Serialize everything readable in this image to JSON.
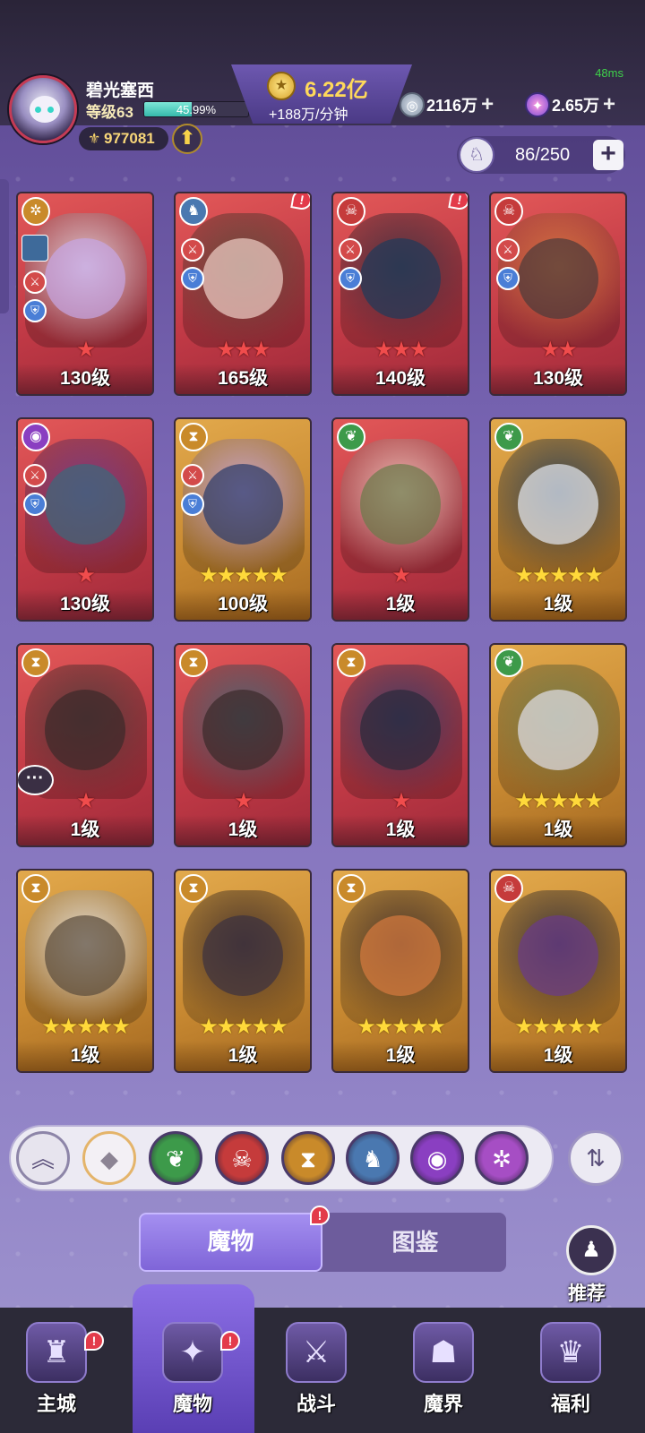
{
  "status": {
    "ping": "48ms"
  },
  "player": {
    "name": "碧光塞西",
    "level": "等级63",
    "xp_percent": "45.99%",
    "xp_fraction": 0.4599,
    "power": "977081"
  },
  "gold": {
    "amount": "6.22亿",
    "rate": "+188万/分钟"
  },
  "resources": [
    {
      "icon": "silver-coin-icon",
      "value": "2116万",
      "plus": "+"
    },
    {
      "icon": "star-gem-icon",
      "value": "2.65万",
      "plus": "+"
    }
  ],
  "capacity": {
    "value": "86/250",
    "plus": "+"
  },
  "monsters": [
    {
      "level": "130级",
      "stars": "★",
      "tier": "red",
      "faction": "purple-gold",
      "faction_icon": "swirl-faction-icon",
      "alert": false,
      "badges": true
    },
    {
      "level": "165级",
      "stars": "★★★",
      "tier": "red",
      "faction": "blue",
      "faction_icon": "dragon-faction-icon",
      "alert": true,
      "badges": true
    },
    {
      "level": "140级",
      "stars": "★★★",
      "tier": "red",
      "faction": "red",
      "faction_icon": "demon-faction-icon",
      "alert": true,
      "badges": true
    },
    {
      "level": "130级",
      "stars": "★★",
      "tier": "red",
      "faction": "red",
      "faction_icon": "demon-faction-icon",
      "alert": false,
      "badges": true
    },
    {
      "level": "130级",
      "stars": "★",
      "tier": "red",
      "faction": "purple",
      "faction_icon": "eye-faction-icon",
      "alert": false,
      "badges": true
    },
    {
      "level": "100级",
      "stars": "★★★★★",
      "tier": "gold",
      "faction": "gold",
      "faction_icon": "hourglass-faction-icon",
      "alert": false,
      "badges": true
    },
    {
      "level": "1级",
      "stars": "★",
      "tier": "red",
      "faction": "green",
      "faction_icon": "leaf-faction-icon",
      "alert": false,
      "badges": false
    },
    {
      "level": "1级",
      "stars": "★★★★★",
      "tier": "gold",
      "faction": "green",
      "faction_icon": "leaf-faction-icon",
      "alert": false,
      "badges": false
    },
    {
      "level": "1级",
      "stars": "★",
      "tier": "red",
      "faction": "gold",
      "faction_icon": "hourglass-faction-icon",
      "alert": false,
      "badges": false
    },
    {
      "level": "1级",
      "stars": "★",
      "tier": "red",
      "faction": "gold",
      "faction_icon": "hourglass-faction-icon",
      "alert": false,
      "badges": false
    },
    {
      "level": "1级",
      "stars": "★",
      "tier": "red",
      "faction": "gold",
      "faction_icon": "hourglass-faction-icon",
      "alert": false,
      "badges": false
    },
    {
      "level": "1级",
      "stars": "★★★★★",
      "tier": "gold",
      "faction": "green",
      "faction_icon": "leaf-faction-icon",
      "alert": false,
      "badges": false
    },
    {
      "level": "1级",
      "stars": "★★★★★",
      "tier": "gold",
      "faction": "gold",
      "faction_icon": "hourglass-faction-icon",
      "alert": false,
      "badges": false
    },
    {
      "level": "1级",
      "stars": "★★★★★",
      "tier": "gold",
      "faction": "gold",
      "faction_icon": "hourglass-faction-icon",
      "alert": false,
      "badges": false
    },
    {
      "level": "1级",
      "stars": "★★★★★",
      "tier": "gold",
      "faction": "gold",
      "faction_icon": "hourglass-faction-icon",
      "alert": false,
      "badges": false
    },
    {
      "level": "1级",
      "stars": "★★★★★",
      "tier": "gold",
      "faction": "red",
      "faction_icon": "demon-faction-icon",
      "alert": false,
      "badges": false
    }
  ],
  "filters": [
    {
      "name": "collapse-up-icon",
      "glyph": "︽"
    },
    {
      "name": "all-factions-icon",
      "glyph": "◆"
    },
    {
      "name": "leaf-faction-filter-icon",
      "glyph": "❦"
    },
    {
      "name": "demon-faction-filter-icon",
      "glyph": "☠"
    },
    {
      "name": "hourglass-faction-filter-icon",
      "glyph": "⧗"
    },
    {
      "name": "dragon-faction-filter-icon",
      "glyph": "♞"
    },
    {
      "name": "eye-faction-filter-icon",
      "glyph": "◉"
    },
    {
      "name": "swirl-faction-filter-icon",
      "glyph": "✲"
    }
  ],
  "tabs": {
    "monsters": "魔物",
    "codex": "图鉴"
  },
  "recommend": {
    "label": "推荐"
  },
  "nav": [
    {
      "label": "主城",
      "icon": "castle-icon",
      "glyph": "♜",
      "alert": true
    },
    {
      "label": "魔物",
      "icon": "flame-monster-icon",
      "glyph": "✦",
      "alert": true
    },
    {
      "label": "战斗",
      "icon": "sword-shield-icon",
      "glyph": "⚔",
      "alert": false
    },
    {
      "label": "魔界",
      "icon": "demon-gate-icon",
      "glyph": "☗",
      "alert": false
    },
    {
      "label": "福利",
      "icon": "treasure-chest-icon",
      "glyph": "♛",
      "alert": false
    }
  ],
  "colors": {
    "gold": "#ffd95a",
    "alert": "#e33b4a",
    "card_red": "#c23a46",
    "card_gold": "#c98a32",
    "accent": "#7f65d8"
  }
}
